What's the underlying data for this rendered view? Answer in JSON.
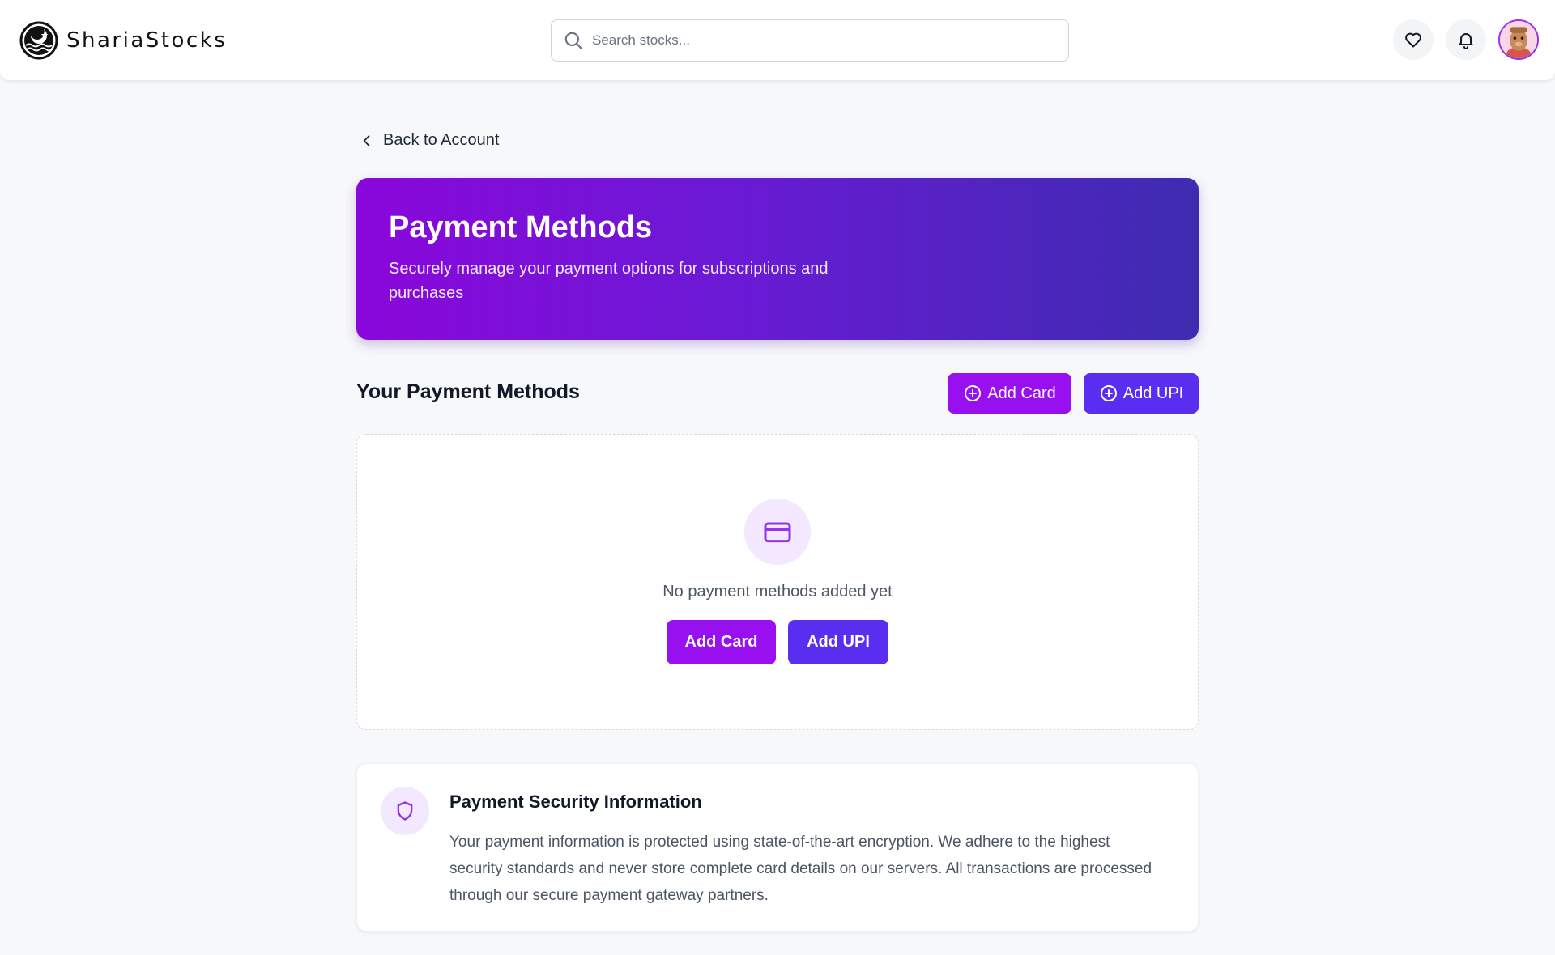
{
  "header": {
    "brand": "ShariaStocks",
    "search_placeholder": "Search stocks..."
  },
  "nav": {
    "back_label": "Back to Account"
  },
  "hero": {
    "title": "Payment Methods",
    "subtitle": "Securely manage your payment options for subscriptions and purchases"
  },
  "section": {
    "title": "Your Payment Methods",
    "add_card_label": "Add Card",
    "add_upi_label": "Add UPI"
  },
  "empty_state": {
    "message": "No payment methods added yet",
    "add_card_label": "Add Card",
    "add_upi_label": "Add UPI"
  },
  "security": {
    "title": "Payment Security Information",
    "body": "Your payment information is protected using state-of-the-art encryption. We adhere to the highest security standards and never store complete card details on our servers. All transactions are processed through our secure payment gateway partners."
  },
  "colors": {
    "accent_purple": "#9810f0",
    "accent_indigo": "#5a2ef0",
    "hero_gradient_start": "#8a07db",
    "hero_gradient_end": "#3d2cb0"
  },
  "icons": {
    "logo": "crescent-star-wave-logo",
    "search": "search-icon",
    "favorites": "heart-icon",
    "notifications": "bell-icon",
    "back": "chevron-left-icon",
    "add": "plus-circle-icon",
    "empty": "credit-card-icon",
    "security": "shield-icon"
  }
}
